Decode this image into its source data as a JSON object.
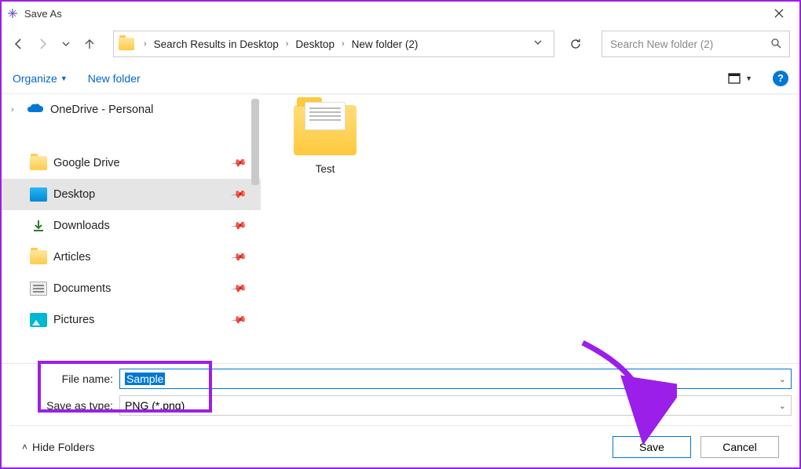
{
  "title": "Save As",
  "breadcrumb": [
    "Search Results in Desktop",
    "Desktop",
    "New folder (2)"
  ],
  "search_placeholder": "Search New folder (2)",
  "toolbar": {
    "organize": "Organize",
    "new_folder": "New folder"
  },
  "tree": {
    "onedrive": "OneDrive - Personal",
    "gdrive": "Google Drive",
    "desktop": "Desktop",
    "downloads": "Downloads",
    "articles": "Articles",
    "documents": "Documents",
    "pictures": "Pictures"
  },
  "content_item": {
    "name": "Test"
  },
  "form": {
    "filename_label": "File name:",
    "filename_value": "Sample",
    "type_label": "Save as type:",
    "type_value": "PNG (*.png)"
  },
  "footer": {
    "hide": "Hide Folders",
    "save": "Save",
    "cancel": "Cancel"
  }
}
